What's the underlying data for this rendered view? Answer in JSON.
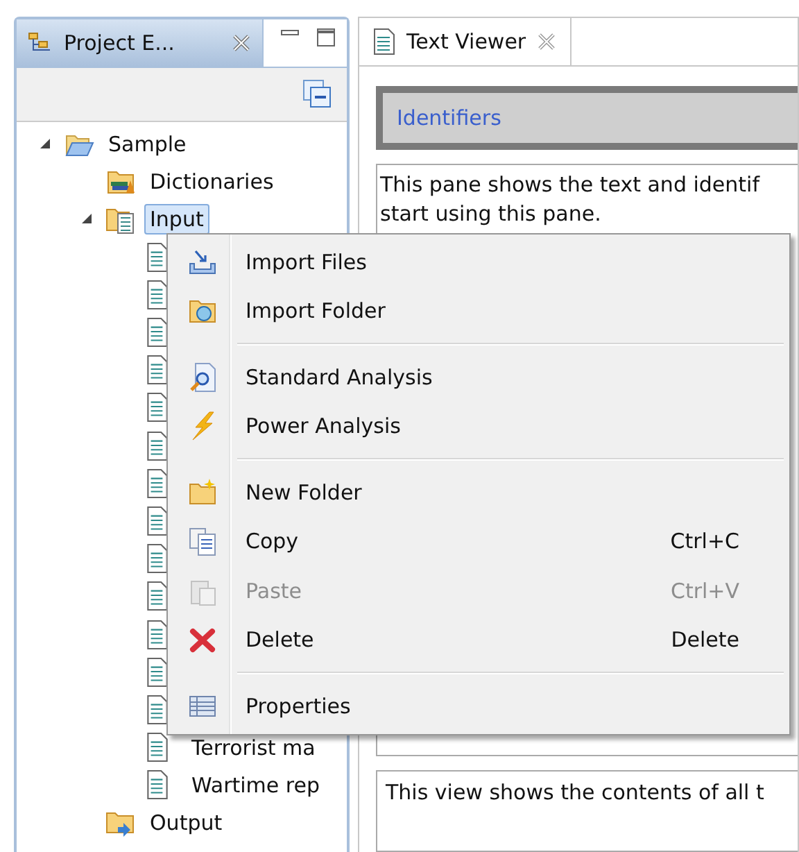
{
  "explorer": {
    "tab": {
      "label": "Project E...",
      "selected": true
    },
    "tree": [
      {
        "label": "Sample",
        "kind": "project",
        "expanded": true,
        "children": [
          {
            "label": "Dictionaries",
            "kind": "dictionaries"
          },
          {
            "label": "Input",
            "kind": "input",
            "expanded": true,
            "selected": true,
            "children": [
              {
                "kind": "file"
              },
              {
                "kind": "file"
              },
              {
                "kind": "file"
              },
              {
                "kind": "file"
              },
              {
                "kind": "file"
              },
              {
                "kind": "file"
              },
              {
                "kind": "file"
              },
              {
                "kind": "file"
              },
              {
                "kind": "file"
              },
              {
                "kind": "file"
              },
              {
                "kind": "file"
              },
              {
                "kind": "file"
              },
              {
                "kind": "file"
              },
              {
                "label": "Terrorist ma",
                "kind": "file"
              },
              {
                "label": "Wartime rep",
                "kind": "file"
              }
            ]
          },
          {
            "label": "Output",
            "kind": "output"
          }
        ]
      }
    ]
  },
  "viewer": {
    "tabs": [
      {
        "label": "Text Viewer",
        "selected": true
      }
    ],
    "section_title": "Identifiers",
    "description_lines": [
      "This pane shows the text and identif",
      "start using this pane."
    ],
    "contents_text": "This view shows the contents of all t"
  },
  "context_menu": {
    "groups": [
      [
        {
          "label": "Import Files",
          "kind": "import-files",
          "disabled": false
        },
        {
          "label": "Import Folder",
          "kind": "import-folder",
          "disabled": false
        }
      ],
      [
        {
          "label": "Standard Analysis",
          "kind": "standard-analysis",
          "disabled": false
        },
        {
          "label": "Power Analysis",
          "kind": "power-analysis",
          "disabled": false
        }
      ],
      [
        {
          "label": "New Folder",
          "kind": "new-folder",
          "disabled": false
        },
        {
          "label": "Copy",
          "kind": "copy",
          "shortcut": "Ctrl+C",
          "disabled": false
        },
        {
          "label": "Paste",
          "kind": "paste",
          "shortcut": "Ctrl+V",
          "disabled": true
        },
        {
          "label": "Delete",
          "kind": "delete",
          "shortcut": "Delete",
          "disabled": false
        }
      ],
      [
        {
          "label": "Properties",
          "kind": "properties",
          "disabled": false
        }
      ]
    ]
  }
}
